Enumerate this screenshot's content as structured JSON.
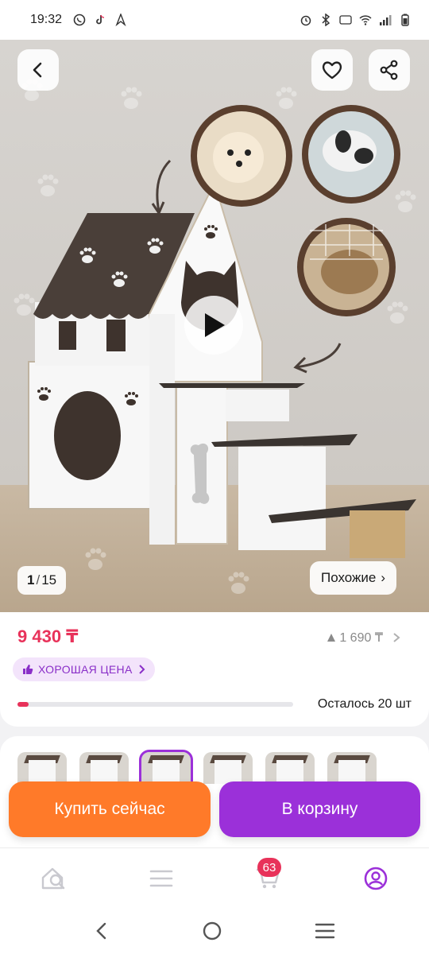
{
  "status_bar": {
    "time": "19:32"
  },
  "gallery": {
    "current_index": "1",
    "separator": "/",
    "total": "15",
    "similar_label": "Похожие",
    "similar_arrow": "›"
  },
  "product": {
    "price": "9 430 ₸",
    "old_price": "1 690 ₸",
    "good_price_label": "ХОРОШАЯ ЦЕНА",
    "stock_remaining_text": "Осталось 20 шт",
    "stock_level_fraction": 0.04
  },
  "actions": {
    "buy_now": "Купить сейчас",
    "add_to_cart": "В корзину"
  },
  "bottom_nav": {
    "cart_badge": "63"
  },
  "colors": {
    "accent_purple": "#9b30d9",
    "price_red": "#e8325a",
    "buy_orange": "#ff7a29"
  }
}
